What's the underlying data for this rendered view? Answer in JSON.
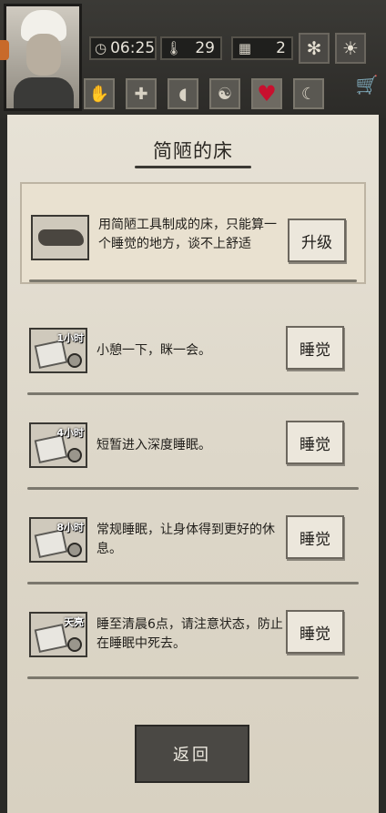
{
  "hud": {
    "time": "06:25",
    "temperature": "29",
    "day": "2"
  },
  "panel": {
    "title": "简陋的床",
    "upgrade": {
      "description": "用简陋工具制成的床，只能算一个睡觉的地方，谈不上舒适",
      "button": "升级"
    },
    "options": [
      {
        "tag": "1小时",
        "description": "小憩一下，眯一会。",
        "button": "睡觉"
      },
      {
        "tag": "4小时",
        "description": "短暂进入深度睡眠。",
        "button": "睡觉"
      },
      {
        "tag": "8小时",
        "description": "常规睡眠，让身体得到更好的休息。",
        "button": "睡觉"
      },
      {
        "tag": "天亮",
        "description": "睡至清晨6点，请注意状态，防止在睡眠中死去。",
        "button": "睡觉"
      }
    ],
    "back_button": "返回"
  },
  "colors": {
    "heart": "#c8102e",
    "paper": "#e2dccf"
  }
}
